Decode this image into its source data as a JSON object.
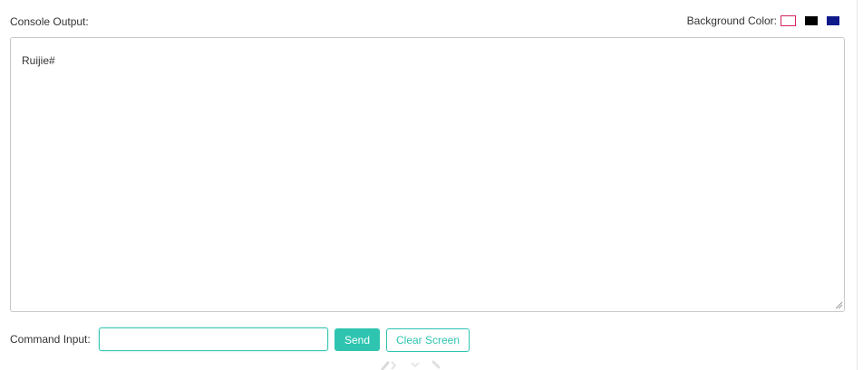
{
  "console": {
    "label": "Console Output:",
    "output": "Ruijie#"
  },
  "background_color": {
    "label": "Background Color:",
    "swatches": [
      {
        "name": "white",
        "color": "#ffffff",
        "selected": true
      },
      {
        "name": "black",
        "color": "#000000",
        "selected": false
      },
      {
        "name": "navy",
        "color": "#0f1a8a",
        "selected": false
      }
    ]
  },
  "command": {
    "label": "Command Input:",
    "value": "",
    "placeholder": "",
    "send_label": "Send",
    "clear_label": "Clear Screen"
  },
  "colors": {
    "accent": "#2ec4b0",
    "selected_outline": "#d6245c"
  },
  "icons": {
    "loading": "loading-spinner-icon",
    "resize": "resize-grip-icon"
  }
}
